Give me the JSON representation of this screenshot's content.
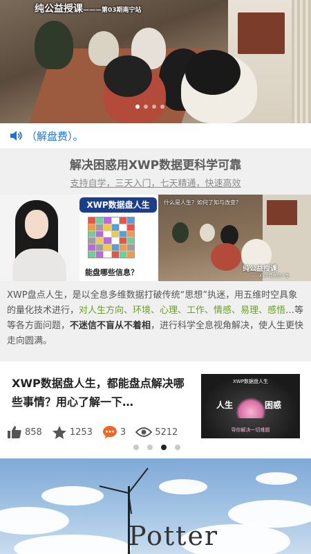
{
  "top_banner": {
    "caption_main": "纯公益授课",
    "caption_sub": "———第03期南宁站",
    "slide_count": 4,
    "active_slide": 0
  },
  "audio": {
    "text": "（解盘费）。",
    "icon": "speaker-icon",
    "color": "#1a73d8"
  },
  "promo": {
    "title": "解决困惑用XWP数据更科学可靠",
    "subtitle": "支持自学，三天入门，七天精通，快速高效",
    "xwp_title": "XWP数据盘人生",
    "xwp_question": "能盘哪些信息？",
    "meeting_question": "什么是人生？如何了知与改变？",
    "meeting_caption": "纯公益授课",
    "meeting_caption_sub": "——XWP数据盘人生",
    "desc_1": "XWP盘点人生，是以全息多维数据打破传统“思想”执迷，用五维时空具象的量化技术进行，",
    "desc_green": "对人生方向、环境、心理、工作、情感、易理、感悟",
    "desc_2": "…等等各方面问题，",
    "desc_bold": "不迷信不盲从不着相",
    "desc_3": "，进行科学全息视角解决，使人生更快走向圆满。",
    "green": "#6a9c2b"
  },
  "article": {
    "headline": "XWP数据盘人生，都能盘点解决哪些事情？用心了解一下…",
    "thumb_top": "XWP数据盘人生",
    "thumb_left": "人生",
    "thumb_right": "困惑",
    "thumb_bottom": "导你解决一切难题",
    "likes": "858",
    "stars": "1253",
    "comments": "3",
    "views": "5212",
    "icons": [
      "thumbs-up-icon",
      "star-icon",
      "comment-icon",
      "eye-icon"
    ],
    "pager_count": 4,
    "pager_active": 2,
    "comment_color": "#f26522"
  },
  "sky_banner": {
    "text": "Potter"
  }
}
